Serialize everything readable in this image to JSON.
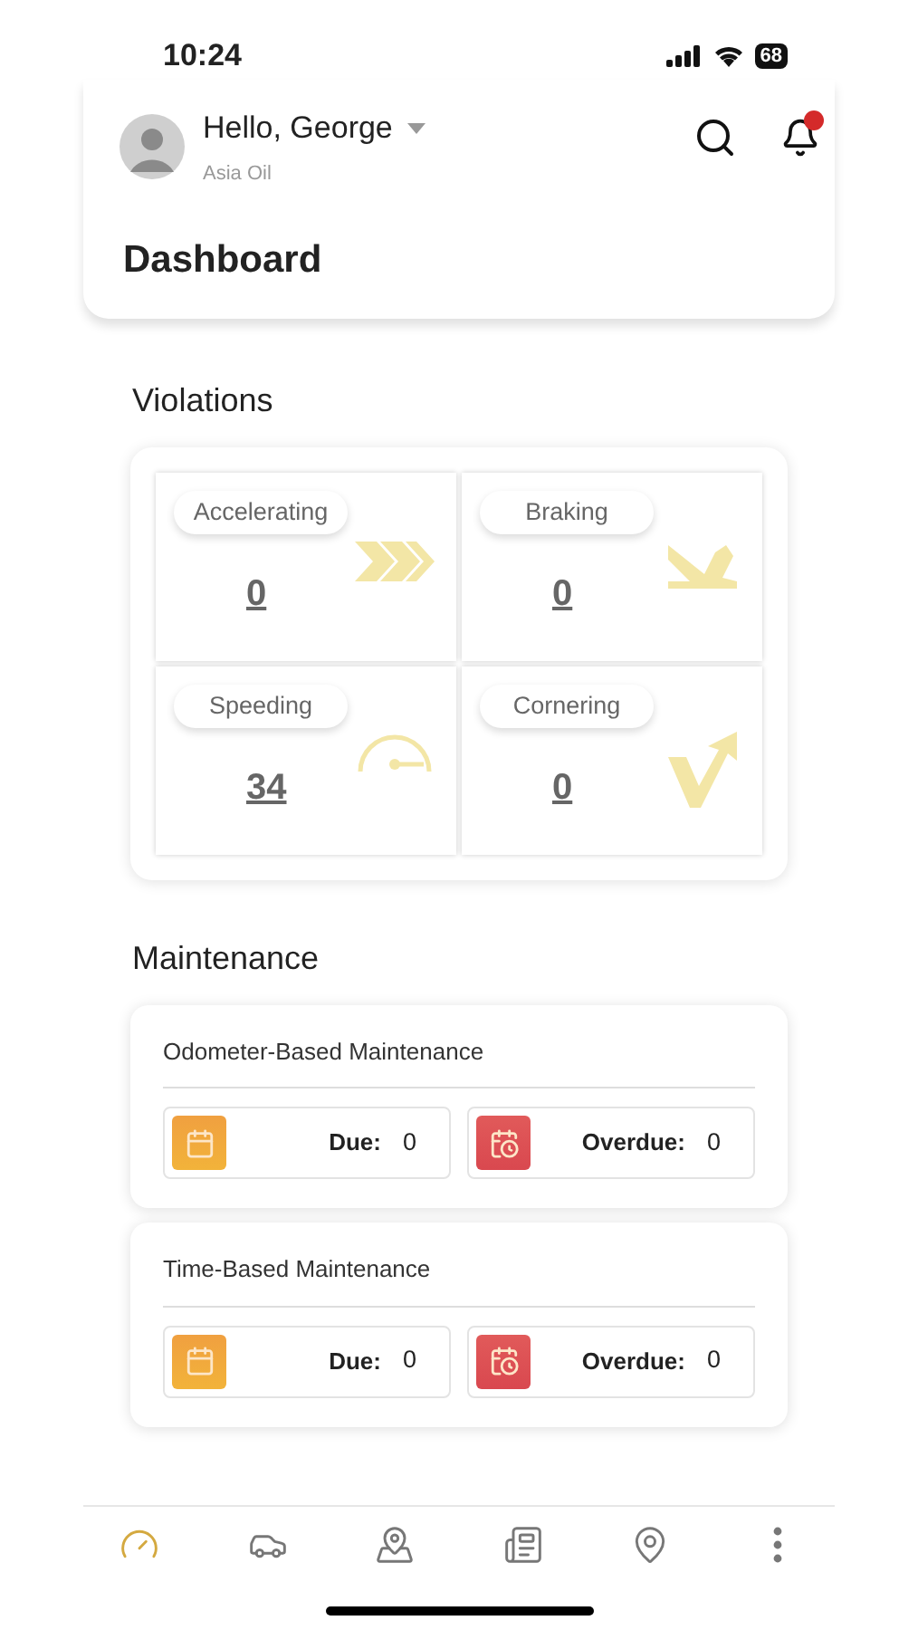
{
  "status_bar": {
    "time": "10:24",
    "battery": "68"
  },
  "header": {
    "greeting": "Hello, George",
    "company": "Asia Oil",
    "notification_dot": true
  },
  "page_title": "Dashboard",
  "violations": {
    "title": "Violations",
    "items": [
      {
        "label": "Accelerating",
        "value": "0",
        "kind": "accelerating"
      },
      {
        "label": "Braking",
        "value": "0",
        "kind": "braking"
      },
      {
        "label": "Speeding",
        "value": "34",
        "kind": "speeding"
      },
      {
        "label": "Cornering",
        "value": "0",
        "kind": "cornering"
      }
    ]
  },
  "maintenance": {
    "title": "Maintenance",
    "cards": [
      {
        "title": "Odometer-Based Maintenance",
        "tiles": [
          {
            "kind": "due",
            "label": "Due:",
            "value": "0"
          },
          {
            "kind": "overdue",
            "label": "Overdue:",
            "value": "0"
          }
        ]
      },
      {
        "title": "Time-Based Maintenance",
        "tiles": [
          {
            "kind": "due",
            "label": "Due:",
            "value": "0"
          },
          {
            "kind": "overdue",
            "label": "Overdue:",
            "value": "0"
          }
        ]
      }
    ]
  },
  "nav": [
    {
      "kind": "dashboard",
      "selected": true
    },
    {
      "kind": "vehicles",
      "selected": false
    },
    {
      "kind": "map",
      "selected": false
    },
    {
      "kind": "reports",
      "selected": false
    },
    {
      "kind": "location",
      "selected": false
    },
    {
      "kind": "more",
      "selected": false
    }
  ]
}
